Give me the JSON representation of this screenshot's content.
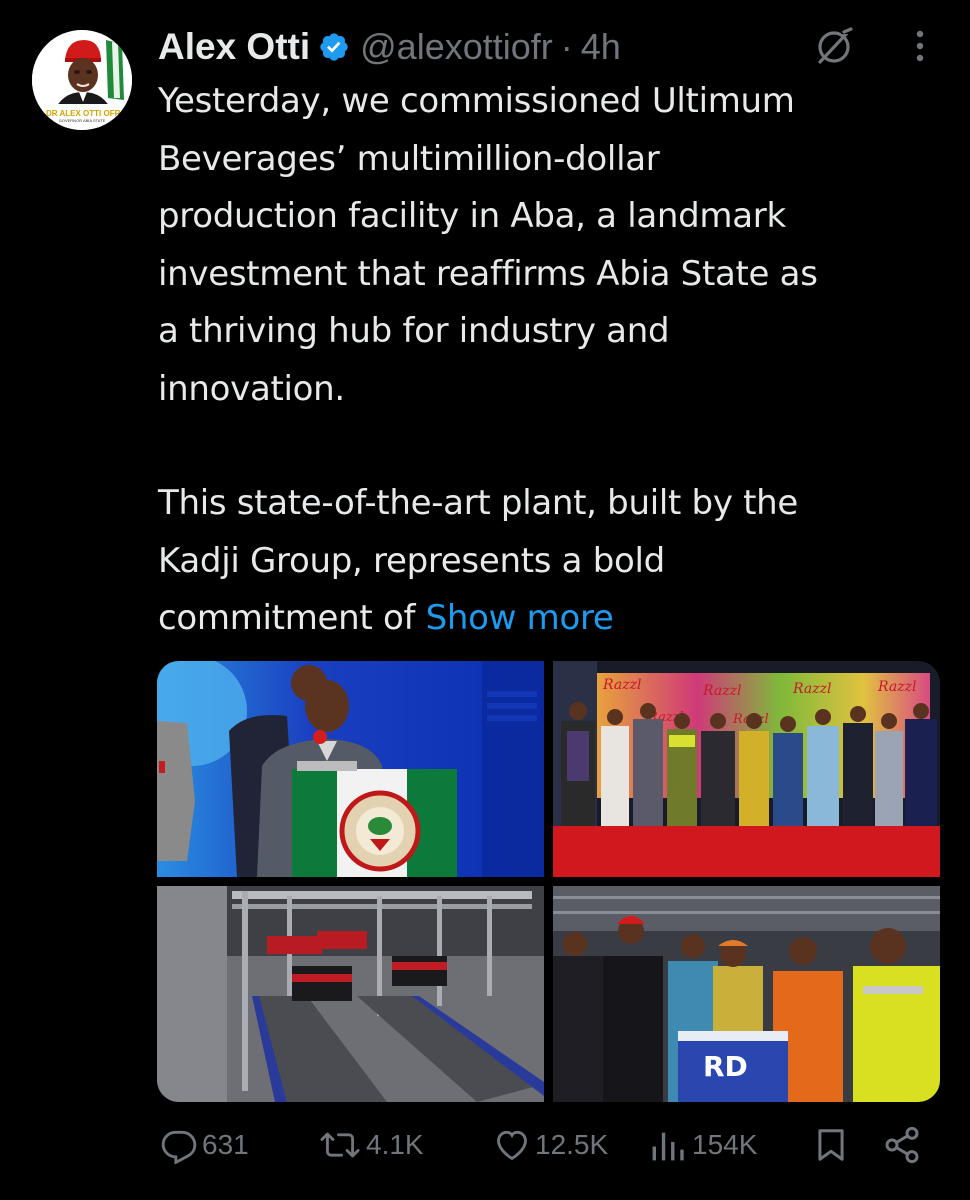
{
  "avatar": {
    "caption_line1": "DR ALEX OTTI OFR",
    "caption_line2": "GOVERNOR ABIA STATE"
  },
  "tweet": {
    "author_name": "Alex Otti",
    "handle": "@alexottiofr",
    "separator": "·",
    "time": "4h",
    "text_lines_1": [
      "Yesterday, we commissioned Ultimum",
      "Beverages’ multimillion-dollar",
      "production facility in Aba, a landmark",
      "investment that reaffirms Abia State as",
      "a thriving hub for industry and",
      "innovation."
    ],
    "text_lines_2": [
      "This state-of-the-art plant, built by the",
      "Kadji Group, represents a bold",
      "commitment of "
    ],
    "show_more": "Show more"
  },
  "media": {
    "podium_seal_text": "SEAL OF THE GOVERNOR OF ABIA STATE",
    "banner_brand": "Razzl"
  },
  "actions": {
    "replies": "631",
    "reposts": "4.1K",
    "likes": "12.5K",
    "views": "154K"
  },
  "icons": [
    "verified-badge-icon",
    "grok-icon",
    "more-icon",
    "reply-icon",
    "repost-icon",
    "like-icon",
    "views-icon",
    "bookmark-icon",
    "share-icon"
  ],
  "colors": {
    "background": "#000000",
    "text": "#e7e9ea",
    "muted": "#71767b",
    "accent": "#1d9bf0"
  }
}
